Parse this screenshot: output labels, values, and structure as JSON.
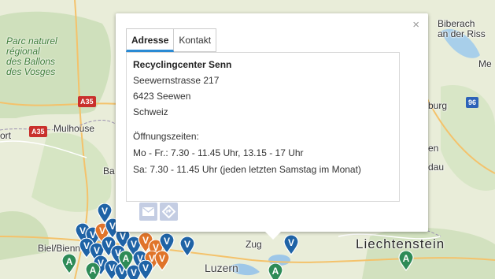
{
  "map": {
    "labels": {
      "park": "Parc naturel\nrégional\ndes Ballons\ndes Vosges",
      "mulhouse": "Mulhouse",
      "biel": "Biel/Bienne",
      "zug": "Zug",
      "luzern": "Luzern",
      "liechtenstein": "Liechtenstein",
      "biberach": "Biberach\nan der Riss",
      "burg": "burg",
      "me": "Me",
      "ba": "Ba",
      "ort": "ort",
      "en": "en",
      "dau": "dau"
    },
    "roads": {
      "a35_top": "A35",
      "a35_left": "A35",
      "r96": "96"
    },
    "marker_letters": {
      "v": "V",
      "a": "A"
    },
    "colors": {
      "marker_blue": "#1f63a6",
      "marker_green": "#2e8b57",
      "marker_orange": "#e0742a"
    }
  },
  "popup": {
    "close": "×",
    "tabs": {
      "address": "Adresse",
      "contact": "Kontakt"
    },
    "address": {
      "name": "Recyclingcenter Senn",
      "street": "Seewernstrasse 217",
      "city": "6423 Seewen",
      "country": "Schweiz",
      "hours_label": "Öffnungszeiten:",
      "hours_weekday": "Mo - Fr.: 7.30 - 11.45 Uhr, 13.15 - 17 Uhr",
      "hours_saturday": "Sa: 7.30 - 11.45 Uhr (jeden letzten Samstag im Monat)"
    },
    "actions": {
      "email": "email-icon",
      "directions": "directions-icon"
    }
  }
}
